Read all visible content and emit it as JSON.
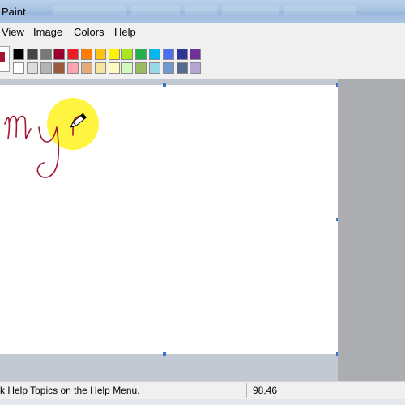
{
  "window": {
    "title": "Paint"
  },
  "menu": {
    "items": [
      "View",
      "Image",
      "Colors",
      "Help"
    ]
  },
  "colors": {
    "foreground": "#a31530",
    "background": "#ffffff",
    "palette_row1": [
      "#000000",
      "#464646",
      "#787878",
      "#990030",
      "#ed1c24",
      "#ff7e00",
      "#ffc20e",
      "#fff200",
      "#a8e61d",
      "#22b14c",
      "#00b7ef",
      "#4d6df3",
      "#2f3699",
      "#6f3198"
    ],
    "palette_row2": [
      "#ffffff",
      "#dcdcdc",
      "#b4b4b4",
      "#9c5a3c",
      "#ffa3b1",
      "#e5aa7a",
      "#f5e49c",
      "#fff9bd",
      "#d3f9bc",
      "#9dbb61",
      "#99d9ea",
      "#709ad1",
      "#546d8e",
      "#b5a5d5"
    ]
  },
  "canvas": {
    "drawing_color": "#a31530",
    "cursor_highlight_color": "#fff200",
    "cursor_icon": "pencil-icon"
  },
  "status": {
    "help_text": "k Help Topics on the Help Menu.",
    "coordinates": "98,46"
  }
}
